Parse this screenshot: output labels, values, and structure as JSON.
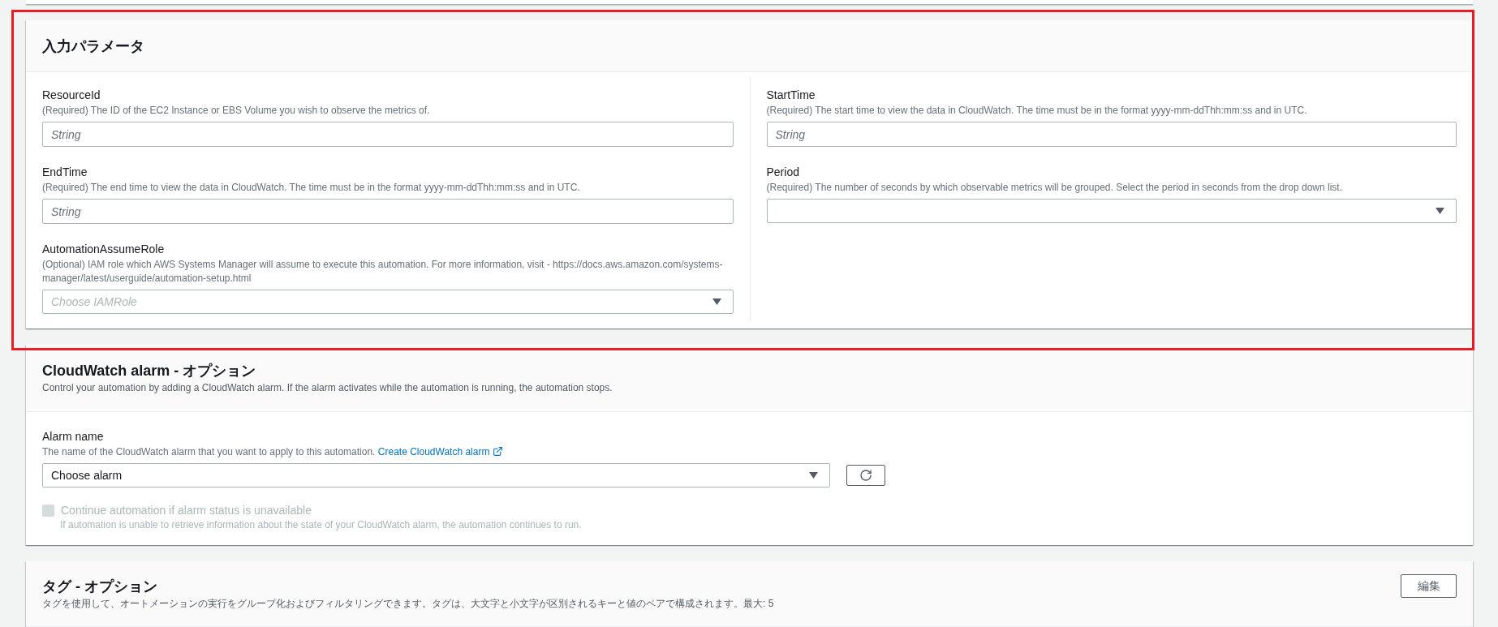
{
  "parameters_panel": {
    "title": "入力パラメータ",
    "columns": [
      [
        {
          "kind": "text",
          "label": "ResourceId",
          "description": "(Required) The ID of the EC2 Instance or EBS Volume you wish to observe the metrics of.",
          "placeholder": "String"
        },
        {
          "kind": "text",
          "label": "EndTime",
          "description": "(Required) The end time to view the data in CloudWatch. The time must be in the format yyyy-mm-ddThh:mm:ss and in UTC.",
          "placeholder": "String"
        },
        {
          "kind": "select",
          "label": "AutomationAssumeRole",
          "description": "(Optional) IAM role which AWS Systems Manager will assume to execute this automation. For more information, visit - https://docs.aws.amazon.com/systems-manager/latest/userguide/automation-setup.html",
          "placeholder": "Choose IAMRole"
        }
      ],
      [
        {
          "kind": "text",
          "label": "StartTime",
          "description": "(Required) The start time to view the data in CloudWatch. The time must be in the format yyyy-mm-ddThh:mm:ss and in UTC.",
          "placeholder": "String"
        },
        {
          "kind": "select",
          "label": "Period",
          "description": "(Required) The number of seconds by which observable metrics will be grouped. Select the period in seconds from the drop down list."
        }
      ]
    ]
  },
  "alarm_panel": {
    "title": "CloudWatch alarm - オプション",
    "description": "Control your automation by adding a CloudWatch alarm. If the alarm activates while the automation is running, the automation stops.",
    "alarm_name": {
      "label": "Alarm name",
      "description": "The name of the CloudWatch alarm that you want to apply to this automation.",
      "link": "Create CloudWatch alarm",
      "value": "Choose alarm"
    },
    "checkbox": {
      "label": "Continue automation if alarm status is unavailable",
      "note": "If automation is unable to retrieve information about the state of your CloudWatch alarm, the automation continues to run.",
      "checked": false,
      "disabled": true
    }
  },
  "tags_panel": {
    "title": "タグ - オプション",
    "description": "タグを使用して、オートメーションの実行をグループ化およびフィルタリングできます。タグは、大文字と小文字が区別されるキーと値のペアで構成されます。最大: 5",
    "edit_button": "編集"
  }
}
